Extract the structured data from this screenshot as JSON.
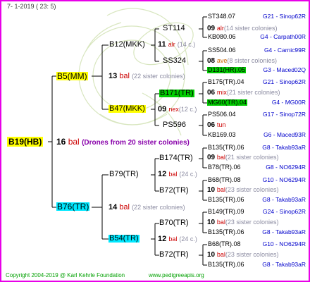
{
  "header": {
    "date": "7-  1-2019 ( 23:  5)"
  },
  "root": {
    "name": "B19(HB)",
    "num": "16",
    "race": "bal",
    "note": "(Drones from 20 sister colonies)"
  },
  "gen1": [
    {
      "name": "B5(MM)",
      "num": "13",
      "race": "bal",
      "note": "(22 sister colonies)"
    },
    {
      "name": "B76(TR)",
      "num": "14",
      "race": "bal",
      "note": "(22 sister colonies)"
    }
  ],
  "gen2": [
    {
      "name": "B12(MKK)",
      "num": "11",
      "race": "alr",
      "note": "(14 c.)"
    },
    {
      "name": "B47(MKK)",
      "num": "09",
      "race": "nex",
      "note": "(12 c.)"
    },
    {
      "name": "B79(TR)",
      "num": "12",
      "race": "bal",
      "note": "(24 c.)"
    },
    {
      "name": "B54(TR)",
      "num": "12",
      "race": "bal",
      "note": "(24 c.)"
    }
  ],
  "gen3": [
    {
      "name": "ST114",
      "num": "09",
      "race": "alr",
      "note": "(14 sister colonies)"
    },
    {
      "name": "SS324",
      "num": "08",
      "race": "ave",
      "note": "(8 sister colonies)"
    },
    {
      "name": "B171(TR)",
      "num": "06",
      "race": "mix",
      "note": "(21 sister colonies)"
    },
    {
      "name": "PS596",
      "num": "06",
      "race": "tun",
      "note": ""
    },
    {
      "name": "B174(TR)",
      "num": "09",
      "race": "bal",
      "note": "(21 sister colonies)"
    },
    {
      "name": "B72(TR)",
      "num": "10",
      "race": "bal",
      "note": "(23 sister colonies)"
    },
    {
      "name": "B70(TR)",
      "num": "10",
      "race": "bal",
      "note": "(23 sister colonies)"
    },
    {
      "name": "B72(TR)",
      "num": "10",
      "race": "bal",
      "note": "(23 sister colonies)"
    }
  ],
  "gen4": [
    {
      "name": "ST348.07",
      "loc": "G21 - Sinop62R"
    },
    {
      "name": "KB080.06",
      "loc": "G4 - Carpath00R"
    },
    {
      "name": "SS504.06",
      "loc": "G4 - Carnic99R"
    },
    {
      "name": "D131(HR).05",
      "loc": "G3 - Maced02Q"
    },
    {
      "name": "B175(TR).04",
      "loc": "G21 - Sinop62R"
    },
    {
      "name": "MG60(TR).04",
      "loc": "G4 - MG00R"
    },
    {
      "name": "PS506.04",
      "loc": "G17 - Sinop72R"
    },
    {
      "name": "KB169.03",
      "loc": "G6 - Maced93R"
    },
    {
      "name": "B135(TR).06",
      "loc": "G8 - Takab93aR"
    },
    {
      "name": "B78(TR).06",
      "loc": "G8 - NO6294R"
    },
    {
      "name": "B68(TR).08",
      "loc": "G10 - NO6294R"
    },
    {
      "name": "B135(TR).06",
      "loc": "G8 - Takab93aR"
    },
    {
      "name": "B149(TR).09",
      "loc": "G24 - Sinop62R"
    },
    {
      "name": "B135(TR).06",
      "loc": "G8 - Takab93aR"
    },
    {
      "name": "B68(TR).08",
      "loc": "G10 - NO6294R"
    },
    {
      "name": "B135(TR).06",
      "loc": "G8 - Takab93aR"
    }
  ],
  "footer": {
    "copyright": "Copyright 2004-2019 @ Karl Kehrle Foundation",
    "site": "www.pedigreeapis.org"
  },
  "colors": {
    "frame": "#e800e8",
    "yellow": "#ffff00",
    "cyan": "#00e8ff",
    "green": "#00cc00",
    "lines": "#000000",
    "location": "#0000cc",
    "race": "#cc0000"
  }
}
